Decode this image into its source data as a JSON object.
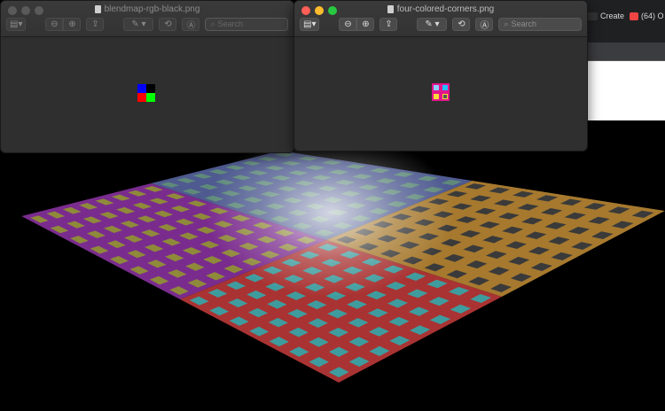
{
  "background_browser": {
    "tabs": [
      {
        "label": "Create"
      },
      {
        "label": "(64) O"
      }
    ]
  },
  "windows": [
    {
      "title": "blendmap-rgb-black.png",
      "active": false,
      "search_placeholder": "Search"
    },
    {
      "title": "four-colored-corners.png",
      "active": true,
      "search_placeholder": "Search"
    }
  ],
  "icons": {
    "sidebar": "sidebar-icon",
    "zoom_out": "zoom-out-icon",
    "zoom_in": "zoom-in-icon",
    "share": "share-icon",
    "markup_pen": "pen-icon",
    "rotate": "rotate-icon",
    "annotate": "markup-icon",
    "search": "search-icon"
  },
  "colors": {
    "blend_tl": "#0000ff",
    "blend_tr": "#000000",
    "blend_bl": "#ff0000",
    "blend_br": "#00ff00",
    "corner_bg": "#e4148c",
    "corner_tl": "#8fd0ff",
    "corner_tr": "#20c0ff",
    "corner_bl": "#ffd93a",
    "corner_br": "#555555",
    "plane_left": "#7a2c8e",
    "plane_right": "#a6792e",
    "plane_front": "#a93333",
    "plane_back": "#4e5a90"
  }
}
